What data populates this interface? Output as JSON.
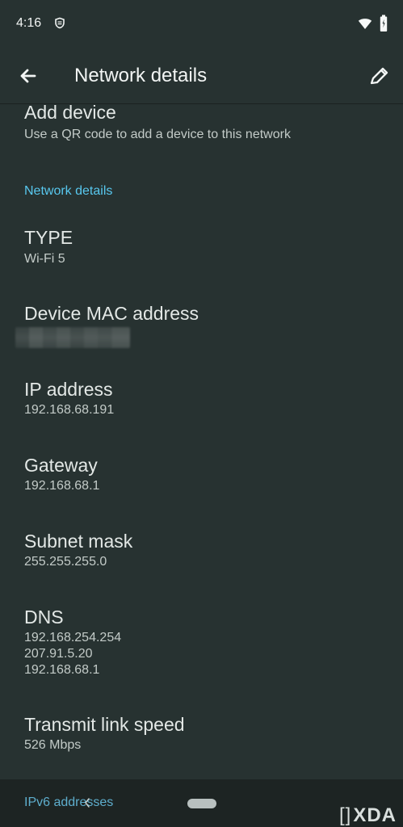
{
  "status_bar": {
    "time": "4:16",
    "app_icon": "shield-icon",
    "wifi_icon": "wifi-icon",
    "battery_icon": "battery-icon"
  },
  "app_bar": {
    "title": "Network details",
    "back_icon": "back-arrow-icon",
    "edit_icon": "edit-icon"
  },
  "top_item": {
    "title": "Add device",
    "description": "Use a QR code to add a device to this network"
  },
  "section": {
    "title": "Network details"
  },
  "details": [
    {
      "title": "TYPE",
      "value": "Wi-Fi 5"
    },
    {
      "title": "Device MAC address",
      "value": ""
    },
    {
      "title": "IP address",
      "value": "192.168.68.191"
    },
    {
      "title": "Gateway",
      "value": "192.168.68.1"
    },
    {
      "title": "Subnet mask",
      "value": "255.255.255.0"
    },
    {
      "title": "DNS",
      "values": [
        "192.168.254.254",
        "207.91.5.20",
        "192.168.68.1"
      ]
    },
    {
      "title": "Transmit link speed",
      "value": "526 Mbps"
    }
  ],
  "bottom": {
    "ipv6_label": "IPv6 addresses",
    "watermark": "XDA"
  },
  "colors": {
    "background": "#273231",
    "accent": "#58c8ef",
    "text_primary": "#e3e8e6",
    "text_secondary": "#c3cbc8"
  }
}
